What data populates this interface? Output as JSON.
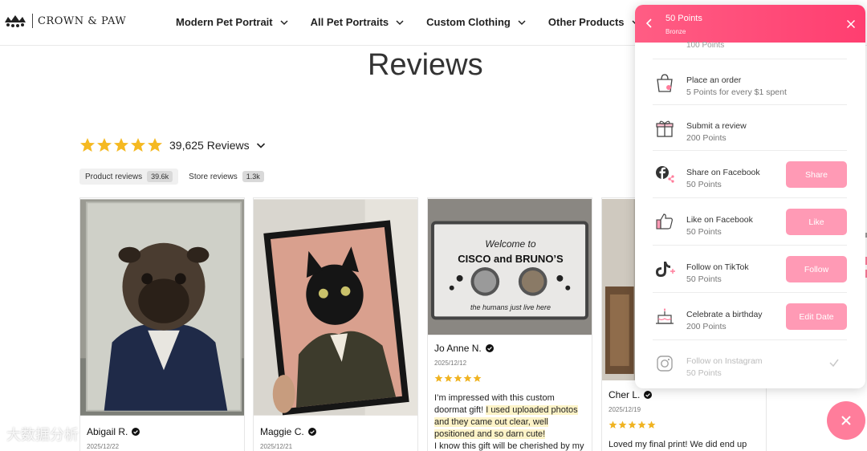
{
  "brand": {
    "name": "CROWN & PAW",
    "logo_icon": "paw-crown-icon"
  },
  "nav": [
    {
      "label": "Modern Pet Portrait"
    },
    {
      "label": "All Pet Portraits"
    },
    {
      "label": "Custom Clothing"
    },
    {
      "label": "Other Products"
    }
  ],
  "page": {
    "title": "Reviews",
    "rating": {
      "stars": 5,
      "count_label": "39,625 Reviews"
    },
    "tabs": [
      {
        "label": "Product reviews",
        "count": "39.6k"
      },
      {
        "label": "Store reviews",
        "count": "1.3k"
      }
    ]
  },
  "reviews": [
    {
      "name": "Abigail R.",
      "date": "2025/12/22",
      "text": ""
    },
    {
      "name": "Maggie C.",
      "date": "2025/12/21",
      "text": ""
    },
    {
      "name": "Jo Anne N.",
      "date": "2025/12/12",
      "text_before": "I’m impressed with this  custom doormat gift! ",
      "text_highlight": " I used uploaded photos and they came out clear, well positioned and so darn cute!",
      "text_after": "I know this gift will be cherished by my",
      "doormat": {
        "line1": "Welcome to",
        "line2": "CISCO and BRUNO’S",
        "line3": "the humans just live here"
      }
    },
    {
      "name": "Cher L.",
      "date": "2025/12/19",
      "text": "Loved my final print! We did end up"
    }
  ],
  "panel": {
    "title": "50 Points",
    "tier": "Bronze",
    "partial_text": "100 Points",
    "rows": [
      {
        "title": "Place an order",
        "sub": "5 Points for every $1 spent",
        "icon": "shopping-bag-icon"
      },
      {
        "title": "Submit a review",
        "sub": "200 Points",
        "icon": "gift-icon"
      },
      {
        "title": "Share on Facebook",
        "sub": "50 Points",
        "icon": "facebook-share-icon",
        "button": "Share"
      },
      {
        "title": "Like on Facebook",
        "sub": "50 Points",
        "icon": "thumbs-up-icon",
        "button": "Like"
      },
      {
        "title": "Follow on TikTok",
        "sub": "50 Points",
        "icon": "tiktok-icon",
        "button": "Follow"
      },
      {
        "title": "Celebrate a birthday",
        "sub": "200 Points",
        "icon": "birthday-cake-icon",
        "button": "Edit Date"
      },
      {
        "title": "Follow on Instagram",
        "sub": "50 Points",
        "icon": "instagram-icon",
        "done": true
      }
    ]
  },
  "watermark": "大数据分析",
  "colors": {
    "accent": "#ff4d7a",
    "button": "#ff9ab5",
    "star": "#f5b921",
    "review_star": "#f0b321"
  }
}
